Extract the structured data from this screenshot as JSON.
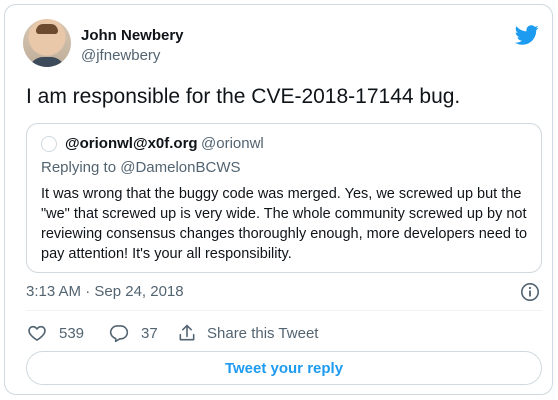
{
  "author": {
    "name": "John Newbery",
    "handle": "@jfnewbery"
  },
  "tweet": {
    "text": "I am responsible for the CVE-2018-17144 bug.",
    "timestamp": "3:13 AM · Sep 24, 2018"
  },
  "quoted": {
    "name": "@orionwl@x0f.org",
    "handle": "@orionwl",
    "replying_prefix": "Replying to",
    "replying_to": "@DamelonBCWS",
    "body": "It was wrong that the buggy code was merged. Yes, we screwed up but the \"we\" that screwed up is very wide. The whole community screwed up by not reviewing consensus changes thoroughly enough, more developers need to pay attention! It's your all responsibility."
  },
  "actions": {
    "likes": "539",
    "replies": "37",
    "share_label": "Share this Tweet"
  },
  "reply_button": "Tweet your reply",
  "colors": {
    "accent": "#1d9bf0",
    "muted": "#536471",
    "border": "#cfd9de"
  },
  "icons": [
    "twitter-bird-icon",
    "info-icon",
    "heart-icon",
    "reply-icon",
    "share-icon"
  ]
}
